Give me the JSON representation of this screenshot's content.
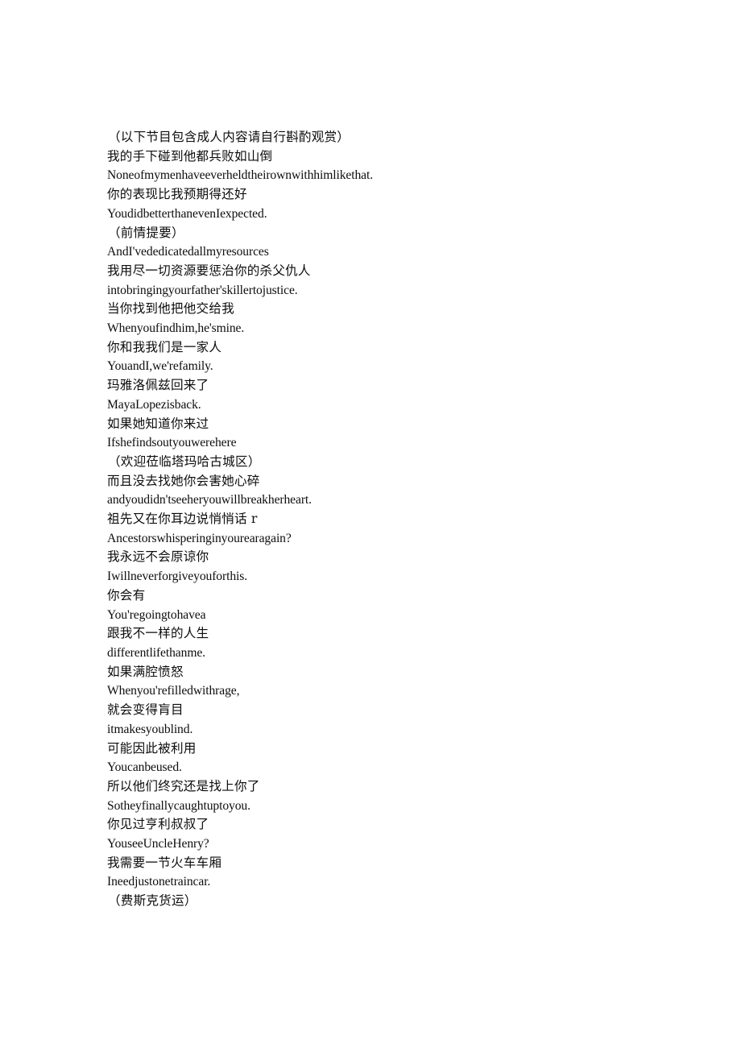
{
  "document": {
    "page_background": "#ffffff",
    "text_color": "#0d0d0d",
    "lines": [
      {
        "text": "（以下节目包含成人内容请自行斟酌观赏）",
        "script": "cjk",
        "paren": true
      },
      {
        "text": "我的手下碰到他都兵败如山倒",
        "script": "cjk",
        "paren": false
      },
      {
        "text": "Noneofmymenhaveeverheldtheirownwithhimlikethat.",
        "script": "latin",
        "paren": false
      },
      {
        "text": "你的表现比我预期得还好",
        "script": "cjk",
        "paren": false
      },
      {
        "text": "YoudidbetterthanevenIexpected.",
        "script": "latin",
        "paren": false
      },
      {
        "text": "（前情提要）",
        "script": "cjk",
        "paren": true
      },
      {
        "text": "AndI'vededicatedallmyresources",
        "script": "latin",
        "paren": false
      },
      {
        "text": "我用尽一切资源要惩治你的杀父仇人",
        "script": "cjk",
        "paren": false
      },
      {
        "text": "intobringingyourfather'skillertojustice.",
        "script": "latin",
        "paren": false
      },
      {
        "text": "当你找到他把他交给我",
        "script": "cjk",
        "paren": false
      },
      {
        "text": "Whenyoufindhim,he'smine.",
        "script": "latin",
        "paren": false
      },
      {
        "text": "你和我我们是一家人",
        "script": "cjk",
        "paren": false
      },
      {
        "text": "YouandI,we'refamily.",
        "script": "latin",
        "paren": false
      },
      {
        "text": "玛雅洛佩兹回来了",
        "script": "cjk",
        "paren": false
      },
      {
        "text": "MayaLopezisback.",
        "script": "latin",
        "paren": false
      },
      {
        "text": "如果她知道你来过",
        "script": "cjk",
        "paren": false
      },
      {
        "text": "Ifshefindsoutyouwerehere",
        "script": "latin",
        "paren": false
      },
      {
        "text": "（欢迎莅临塔玛哈古城区）",
        "script": "cjk",
        "paren": true
      },
      {
        "text": "而且没去找她你会害她心碎",
        "script": "cjk",
        "paren": false
      },
      {
        "text": "andyoudidn'tseeheryouwillbreakherheart.",
        "script": "latin",
        "paren": false
      },
      {
        "text": "祖先又在你耳边说悄悄话 r",
        "script": "cjk",
        "paren": false
      },
      {
        "text": "Ancestorswhisperinginyourearagain?",
        "script": "latin",
        "paren": false
      },
      {
        "text": "我永远不会原谅你",
        "script": "cjk",
        "paren": false
      },
      {
        "text": "Iwillneverforgiveyouforthis.",
        "script": "latin",
        "paren": false
      },
      {
        "text": "你会有",
        "script": "cjk",
        "paren": false
      },
      {
        "text": "You'regoingtohavea",
        "script": "latin",
        "paren": false
      },
      {
        "text": "跟我不一样的人生",
        "script": "cjk",
        "paren": false
      },
      {
        "text": "differentlifethanme.",
        "script": "latin",
        "paren": false
      },
      {
        "text": "如果满腔愤怒",
        "script": "cjk",
        "paren": false
      },
      {
        "text": "Whenyou'refilledwithrage,",
        "script": "latin",
        "paren": false
      },
      {
        "text": "就会变得肓目",
        "script": "cjk",
        "paren": false
      },
      {
        "text": "itmakesyoublind.",
        "script": "latin",
        "paren": false
      },
      {
        "text": "可能因此被利用",
        "script": "cjk",
        "paren": false
      },
      {
        "text": "Youcanbeused.",
        "script": "latin",
        "paren": false
      },
      {
        "text": "所以他们终究还是找上你了",
        "script": "cjk",
        "paren": false
      },
      {
        "text": "Sotheyfinallycaughtuptoyou.",
        "script": "latin",
        "paren": false
      },
      {
        "text": "你见过亨利叔叔了",
        "script": "cjk",
        "paren": false
      },
      {
        "text": "YouseeUncleHenry?",
        "script": "latin",
        "paren": false
      },
      {
        "text": "我需要一节火车车厢",
        "script": "cjk",
        "paren": false
      },
      {
        "text": "Ineedjustonetraincar.",
        "script": "latin",
        "paren": false
      },
      {
        "text": "（费斯克货运）",
        "script": "cjk",
        "paren": true
      }
    ]
  }
}
